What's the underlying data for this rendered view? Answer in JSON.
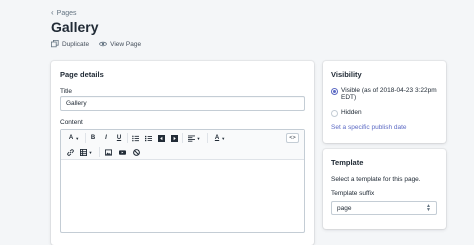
{
  "breadcrumb": {
    "label": "Pages"
  },
  "page": {
    "title": "Gallery"
  },
  "actions": {
    "duplicate": "Duplicate",
    "view_page": "View Page"
  },
  "page_details": {
    "title": "Page details",
    "title_label": "Title",
    "title_value": "Gallery",
    "content_label": "Content",
    "toolbar_row1": [
      "text-style-dropdown",
      "bold",
      "italic",
      "underline",
      "bulleted-list",
      "numbered-list",
      "outdent",
      "indent",
      "align-dropdown",
      "text-color-dropdown"
    ],
    "toolbar_row2": [
      "link",
      "table-dropdown",
      "image",
      "video",
      "block"
    ],
    "html_button": "<>"
  },
  "visibility": {
    "title": "Visibility",
    "visible_label": "Visible (as of 2018-04-23 3:22pm EDT)",
    "hidden_label": "Hidden",
    "selected": "visible",
    "publish_date_link": "Set a specific publish date"
  },
  "template": {
    "title": "Template",
    "help_text": "Select a template for this page.",
    "suffix_label": "Template suffix",
    "suffix_value": "page"
  },
  "colors": {
    "accent": "#5c6ac4",
    "background": "#f4f6f8"
  }
}
